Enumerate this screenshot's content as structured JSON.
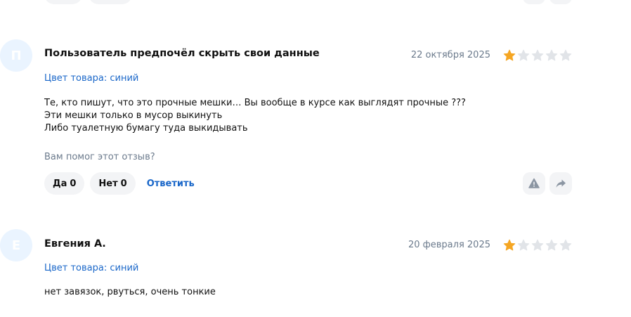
{
  "reviews": [
    {
      "avatar_letter": "П",
      "author": "Пользователь предпочёл скрыть свои данные",
      "date": "22 октября 2025",
      "rating": 1,
      "rating_max": 5,
      "variant": "Цвет товара: синий",
      "text_lines": [
        "Те, кто пишут, что это прочные мешки… Вы вообще в курсе как выглядят прочные ???",
        "Эти мешки только в мусор выкинуть",
        "Либо туалетную бумагу туда выкидывать"
      ],
      "helpful_question": "Вам помог этот отзыв?",
      "yes_label": "Да",
      "yes_count": "0",
      "no_label": "Нет",
      "no_count": "0",
      "reply_label": "Ответить"
    },
    {
      "avatar_letter": "Е",
      "author": "Евгения А.",
      "date": "20 февраля 2025",
      "rating": 1,
      "rating_max": 5,
      "variant": "Цвет товара: синий",
      "text_lines": [
        "нет завязок, рвуться, очень тонкие"
      ]
    }
  ],
  "icons": {
    "report": "warning-icon",
    "share": "share-icon",
    "star": "star-icon"
  },
  "colors": {
    "star_filled": "#f5a623",
    "star_empty": "#e1e4e8",
    "accent_link": "#1a67c9",
    "muted_text": "#6b7a8c",
    "pill_bg": "#f3f4f6",
    "avatar_bg": "#eaf4ff"
  }
}
